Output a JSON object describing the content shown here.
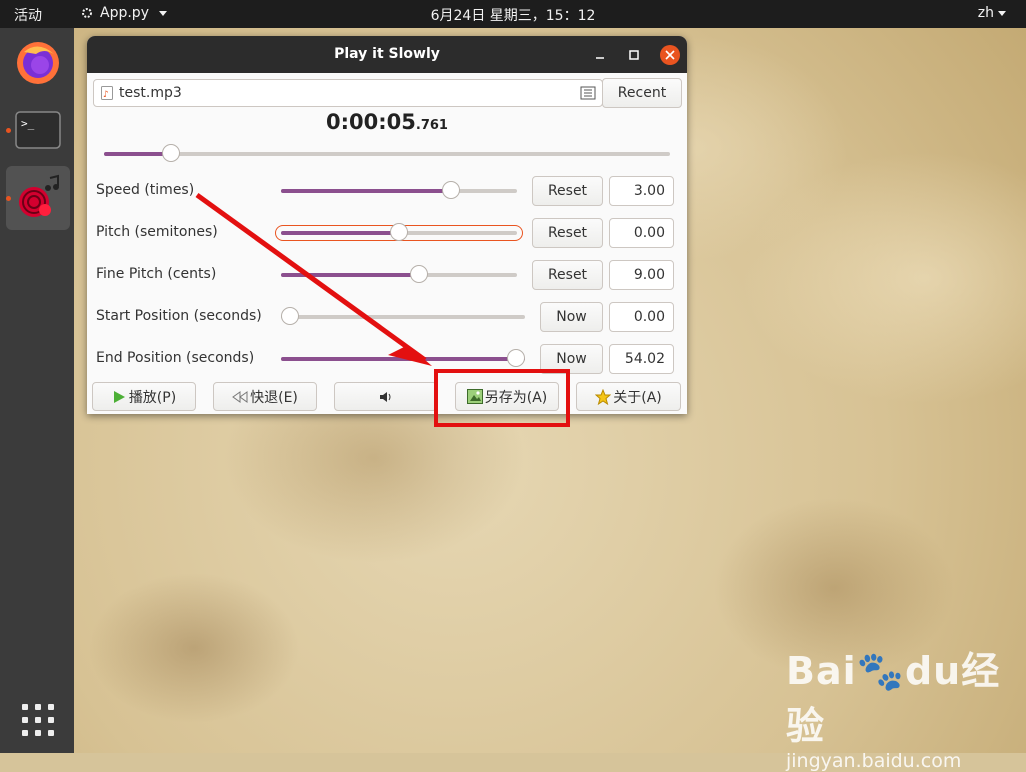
{
  "topbar": {
    "activities": "活动",
    "app_name": "App.py",
    "clock": "6月24日 星期三，15：12",
    "language": "zh"
  },
  "dock": {
    "items": [
      {
        "icon": "firefox-icon",
        "running": false
      },
      {
        "icon": "terminal-icon",
        "running": true
      },
      {
        "icon": "play-it-slowly-icon",
        "running": true
      }
    ],
    "apps_grid_icon": "show-applications-icon"
  },
  "window": {
    "title": "Play it Slowly",
    "file_name": "test.mp3",
    "recent_label": "Recent",
    "position_time": "0:00:05",
    "position_ms": ".761",
    "position_fraction": 0.106,
    "rows": [
      {
        "label": "Speed (times)",
        "button": "Reset",
        "value": "3.00",
        "fraction": 0.74
      },
      {
        "label": "Pitch (semitones)",
        "button": "Reset",
        "value": "0.00",
        "fraction": 0.5
      },
      {
        "label": "Fine Pitch (cents)",
        "button": "Reset",
        "value": "9.00",
        "fraction": 0.59
      },
      {
        "label": "Start Position (seconds)",
        "button": "Now",
        "value": "0.00",
        "fraction": 0.0
      },
      {
        "label": "End Position (seconds)",
        "button": "Now",
        "value": "54.02",
        "fraction": 1.0
      }
    ],
    "buttons": {
      "play": "播放(P)",
      "rewind": "快退(E)",
      "save_as": "另存为(A)",
      "about": "关于(A)"
    }
  },
  "annotation_color": "#e31010",
  "accent": "#e95420",
  "watermark": {
    "brand": "Bai",
    "brand2": "du",
    "brand3": "经验",
    "url": "jingyan.baidu.com"
  }
}
